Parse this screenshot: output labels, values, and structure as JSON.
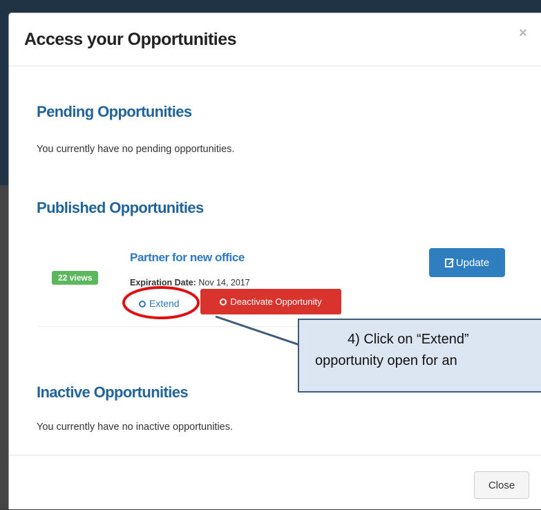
{
  "modal": {
    "title": "Access your Opportunities",
    "close_symbol": "×"
  },
  "sections": {
    "pending": {
      "title": "Pending Opportunities",
      "empty_text": "You currently have no pending opportunities."
    },
    "published": {
      "title": "Published Opportunities"
    },
    "inactive": {
      "title": "Inactive Opportunities",
      "empty_text": "You currently have no inactive opportunities."
    }
  },
  "opportunity": {
    "views_badge": "22 views",
    "title": "Partner for new office",
    "expiration_label": "Expiration Date:",
    "expiration_value": "Nov 14, 2017",
    "extend_label": "Extend",
    "deactivate_label": "Deactivate Opportunity",
    "update_label": "Update"
  },
  "footer": {
    "close_label": "Close"
  },
  "annotation": {
    "line1": "4) Click on “Extend”",
    "line2": "opportunity open for an",
    "circle_color": "#e01010",
    "callout_bg": "#dce6f2",
    "callout_border": "#3f5b7c"
  },
  "colors": {
    "accent_blue": "#2b78c3",
    "section_blue": "#21639b",
    "badge_green": "#5cb85c",
    "danger_red": "#d9332e"
  }
}
